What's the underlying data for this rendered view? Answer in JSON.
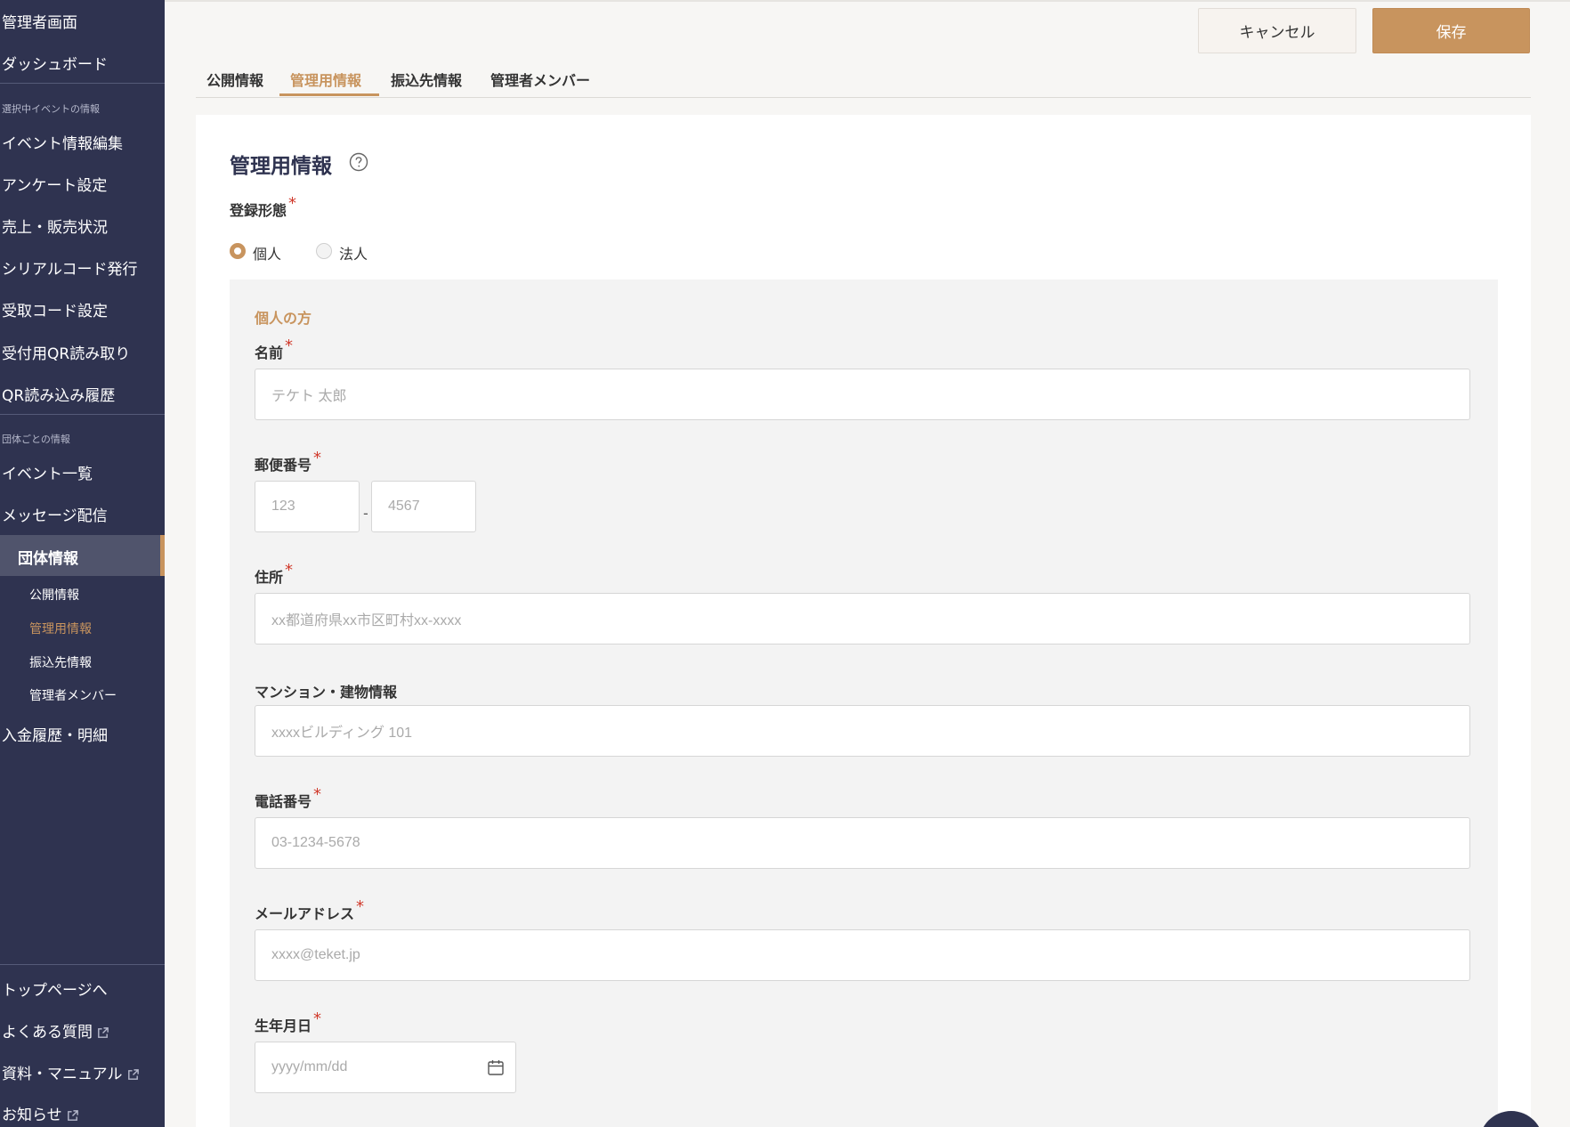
{
  "sidebar": {
    "items_top": [
      "管理者画面",
      "ダッシュボード"
    ],
    "section_event": "選択中イベントの情報",
    "items_event": [
      "イベント情報編集",
      "アンケート設定",
      "売上・販売状況",
      "シリアルコード発行",
      "受取コード設定",
      "受付用QR読み取り",
      "QR読み込み履歴"
    ],
    "section_group": "団体ごとの情報",
    "items_group": [
      "イベント一覧",
      "メッセージ配信"
    ],
    "active_item": "団体情報",
    "sub_items": [
      "公開情報",
      "管理用情報",
      "振込先情報",
      "管理者メンバー"
    ],
    "item_payment": "入金履歴・明細",
    "items_bottom": [
      "トップページへ",
      "よくある質問",
      "資料・マニュアル",
      "お知らせ"
    ]
  },
  "header": {
    "cancel_label": "キャンセル",
    "save_label": "保存"
  },
  "tabs": [
    "公開情報",
    "管理用情報",
    "振込先情報",
    "管理者メンバー"
  ],
  "form": {
    "title": "管理用情報",
    "registration_type_label": "登録形態",
    "required_mark": "*",
    "radio_individual": "個人",
    "radio_corporate": "法人",
    "selected_type": "個人",
    "panel_title": "個人の方",
    "name_label": "名前",
    "name_placeholder": "テケト 太郎",
    "postal_label": "郵便番号",
    "postal1_placeholder": "123",
    "postal_separator": "-",
    "postal2_placeholder": "4567",
    "address_label": "住所",
    "address_placeholder": "xx都道府県xx市区町村xx-xxxx",
    "building_label": "マンション・建物情報",
    "building_placeholder": "xxxxビルディング 101",
    "phone_label": "電話番号",
    "phone_placeholder": "03-1234-5678",
    "email_label": "メールアドレス",
    "email_placeholder": "xxxx@teket.jp",
    "birthdate_label": "生年月日",
    "birthdate_placeholder": "yyyy/mm/dd"
  },
  "colors": {
    "sidebar_bg": "#2f3350",
    "accent": "#c8945e",
    "required": "#d0392b",
    "panel_bg": "#f3f3f3"
  },
  "icons": [
    "help-icon",
    "external-link-icon",
    "calendar-icon"
  ]
}
